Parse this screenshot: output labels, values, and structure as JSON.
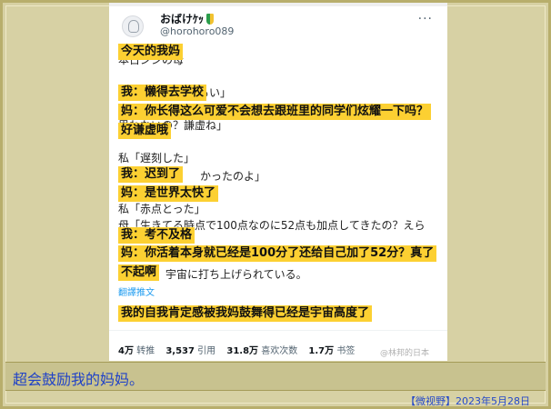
{
  "tweet": {
    "author_name": "おばけｹｯ",
    "author_handle": "@horohoro089",
    "more_icon": "more-dots-icon",
    "translate_label": "翻譯推文",
    "stats": [
      {
        "num": "4万",
        "label": "转推"
      },
      {
        "num": "3,537",
        "label": "引用"
      },
      {
        "num": "31.8万",
        "label": "喜欢次数"
      },
      {
        "num": "1.7万",
        "label": "书签"
      }
    ],
    "watermark": "@林邦的日本"
  },
  "japanese_lines": [
    "本日ジシの母",
    "るい」",
    "思わないの？謙虚ね」",
    "私「遅刻した」",
    "かったのよ」",
    "私「赤点とった」",
    "母「生きてる時点で100点なのに52点も加点してきたの？えら",
    "宇宙に打ち上げられている。"
  ],
  "highlights": [
    "今天的我妈",
    "我：懒得去学校",
    "妈：你长得这么可爱不会想去跟班里的同学们炫耀一下吗？",
    "好谦虚哦",
    "我：迟到了",
    "妈：是世界太快了",
    "我：考不及格",
    "妈：你活着本身就已经是100分了还给自己加了52分？真了",
    "不起啊",
    "我的自我肯定感被我妈鼓舞得已经是宇宙高度了"
  ],
  "caption": "超会鼓励我的妈妈。",
  "source": "【微视野】2023年5月28日"
}
